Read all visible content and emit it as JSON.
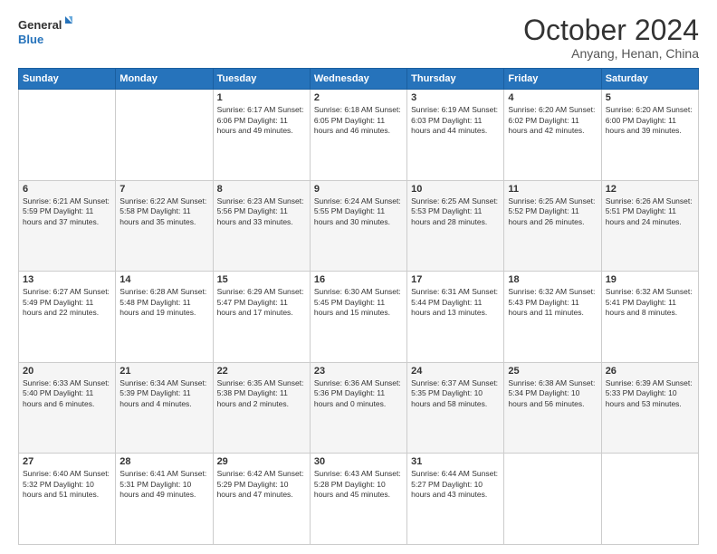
{
  "logo": {
    "line1": "General",
    "line2": "Blue"
  },
  "header": {
    "month": "October 2024",
    "location": "Anyang, Henan, China"
  },
  "weekdays": [
    "Sunday",
    "Monday",
    "Tuesday",
    "Wednesday",
    "Thursday",
    "Friday",
    "Saturday"
  ],
  "weeks": [
    [
      {
        "day": "",
        "detail": ""
      },
      {
        "day": "",
        "detail": ""
      },
      {
        "day": "1",
        "detail": "Sunrise: 6:17 AM\nSunset: 6:06 PM\nDaylight: 11 hours and 49 minutes."
      },
      {
        "day": "2",
        "detail": "Sunrise: 6:18 AM\nSunset: 6:05 PM\nDaylight: 11 hours and 46 minutes."
      },
      {
        "day": "3",
        "detail": "Sunrise: 6:19 AM\nSunset: 6:03 PM\nDaylight: 11 hours and 44 minutes."
      },
      {
        "day": "4",
        "detail": "Sunrise: 6:20 AM\nSunset: 6:02 PM\nDaylight: 11 hours and 42 minutes."
      },
      {
        "day": "5",
        "detail": "Sunrise: 6:20 AM\nSunset: 6:00 PM\nDaylight: 11 hours and 39 minutes."
      }
    ],
    [
      {
        "day": "6",
        "detail": "Sunrise: 6:21 AM\nSunset: 5:59 PM\nDaylight: 11 hours and 37 minutes."
      },
      {
        "day": "7",
        "detail": "Sunrise: 6:22 AM\nSunset: 5:58 PM\nDaylight: 11 hours and 35 minutes."
      },
      {
        "day": "8",
        "detail": "Sunrise: 6:23 AM\nSunset: 5:56 PM\nDaylight: 11 hours and 33 minutes."
      },
      {
        "day": "9",
        "detail": "Sunrise: 6:24 AM\nSunset: 5:55 PM\nDaylight: 11 hours and 30 minutes."
      },
      {
        "day": "10",
        "detail": "Sunrise: 6:25 AM\nSunset: 5:53 PM\nDaylight: 11 hours and 28 minutes."
      },
      {
        "day": "11",
        "detail": "Sunrise: 6:25 AM\nSunset: 5:52 PM\nDaylight: 11 hours and 26 minutes."
      },
      {
        "day": "12",
        "detail": "Sunrise: 6:26 AM\nSunset: 5:51 PM\nDaylight: 11 hours and 24 minutes."
      }
    ],
    [
      {
        "day": "13",
        "detail": "Sunrise: 6:27 AM\nSunset: 5:49 PM\nDaylight: 11 hours and 22 minutes."
      },
      {
        "day": "14",
        "detail": "Sunrise: 6:28 AM\nSunset: 5:48 PM\nDaylight: 11 hours and 19 minutes."
      },
      {
        "day": "15",
        "detail": "Sunrise: 6:29 AM\nSunset: 5:47 PM\nDaylight: 11 hours and 17 minutes."
      },
      {
        "day": "16",
        "detail": "Sunrise: 6:30 AM\nSunset: 5:45 PM\nDaylight: 11 hours and 15 minutes."
      },
      {
        "day": "17",
        "detail": "Sunrise: 6:31 AM\nSunset: 5:44 PM\nDaylight: 11 hours and 13 minutes."
      },
      {
        "day": "18",
        "detail": "Sunrise: 6:32 AM\nSunset: 5:43 PM\nDaylight: 11 hours and 11 minutes."
      },
      {
        "day": "19",
        "detail": "Sunrise: 6:32 AM\nSunset: 5:41 PM\nDaylight: 11 hours and 8 minutes."
      }
    ],
    [
      {
        "day": "20",
        "detail": "Sunrise: 6:33 AM\nSunset: 5:40 PM\nDaylight: 11 hours and 6 minutes."
      },
      {
        "day": "21",
        "detail": "Sunrise: 6:34 AM\nSunset: 5:39 PM\nDaylight: 11 hours and 4 minutes."
      },
      {
        "day": "22",
        "detail": "Sunrise: 6:35 AM\nSunset: 5:38 PM\nDaylight: 11 hours and 2 minutes."
      },
      {
        "day": "23",
        "detail": "Sunrise: 6:36 AM\nSunset: 5:36 PM\nDaylight: 11 hours and 0 minutes."
      },
      {
        "day": "24",
        "detail": "Sunrise: 6:37 AM\nSunset: 5:35 PM\nDaylight: 10 hours and 58 minutes."
      },
      {
        "day": "25",
        "detail": "Sunrise: 6:38 AM\nSunset: 5:34 PM\nDaylight: 10 hours and 56 minutes."
      },
      {
        "day": "26",
        "detail": "Sunrise: 6:39 AM\nSunset: 5:33 PM\nDaylight: 10 hours and 53 minutes."
      }
    ],
    [
      {
        "day": "27",
        "detail": "Sunrise: 6:40 AM\nSunset: 5:32 PM\nDaylight: 10 hours and 51 minutes."
      },
      {
        "day": "28",
        "detail": "Sunrise: 6:41 AM\nSunset: 5:31 PM\nDaylight: 10 hours and 49 minutes."
      },
      {
        "day": "29",
        "detail": "Sunrise: 6:42 AM\nSunset: 5:29 PM\nDaylight: 10 hours and 47 minutes."
      },
      {
        "day": "30",
        "detail": "Sunrise: 6:43 AM\nSunset: 5:28 PM\nDaylight: 10 hours and 45 minutes."
      },
      {
        "day": "31",
        "detail": "Sunrise: 6:44 AM\nSunset: 5:27 PM\nDaylight: 10 hours and 43 minutes."
      },
      {
        "day": "",
        "detail": ""
      },
      {
        "day": "",
        "detail": ""
      }
    ]
  ]
}
